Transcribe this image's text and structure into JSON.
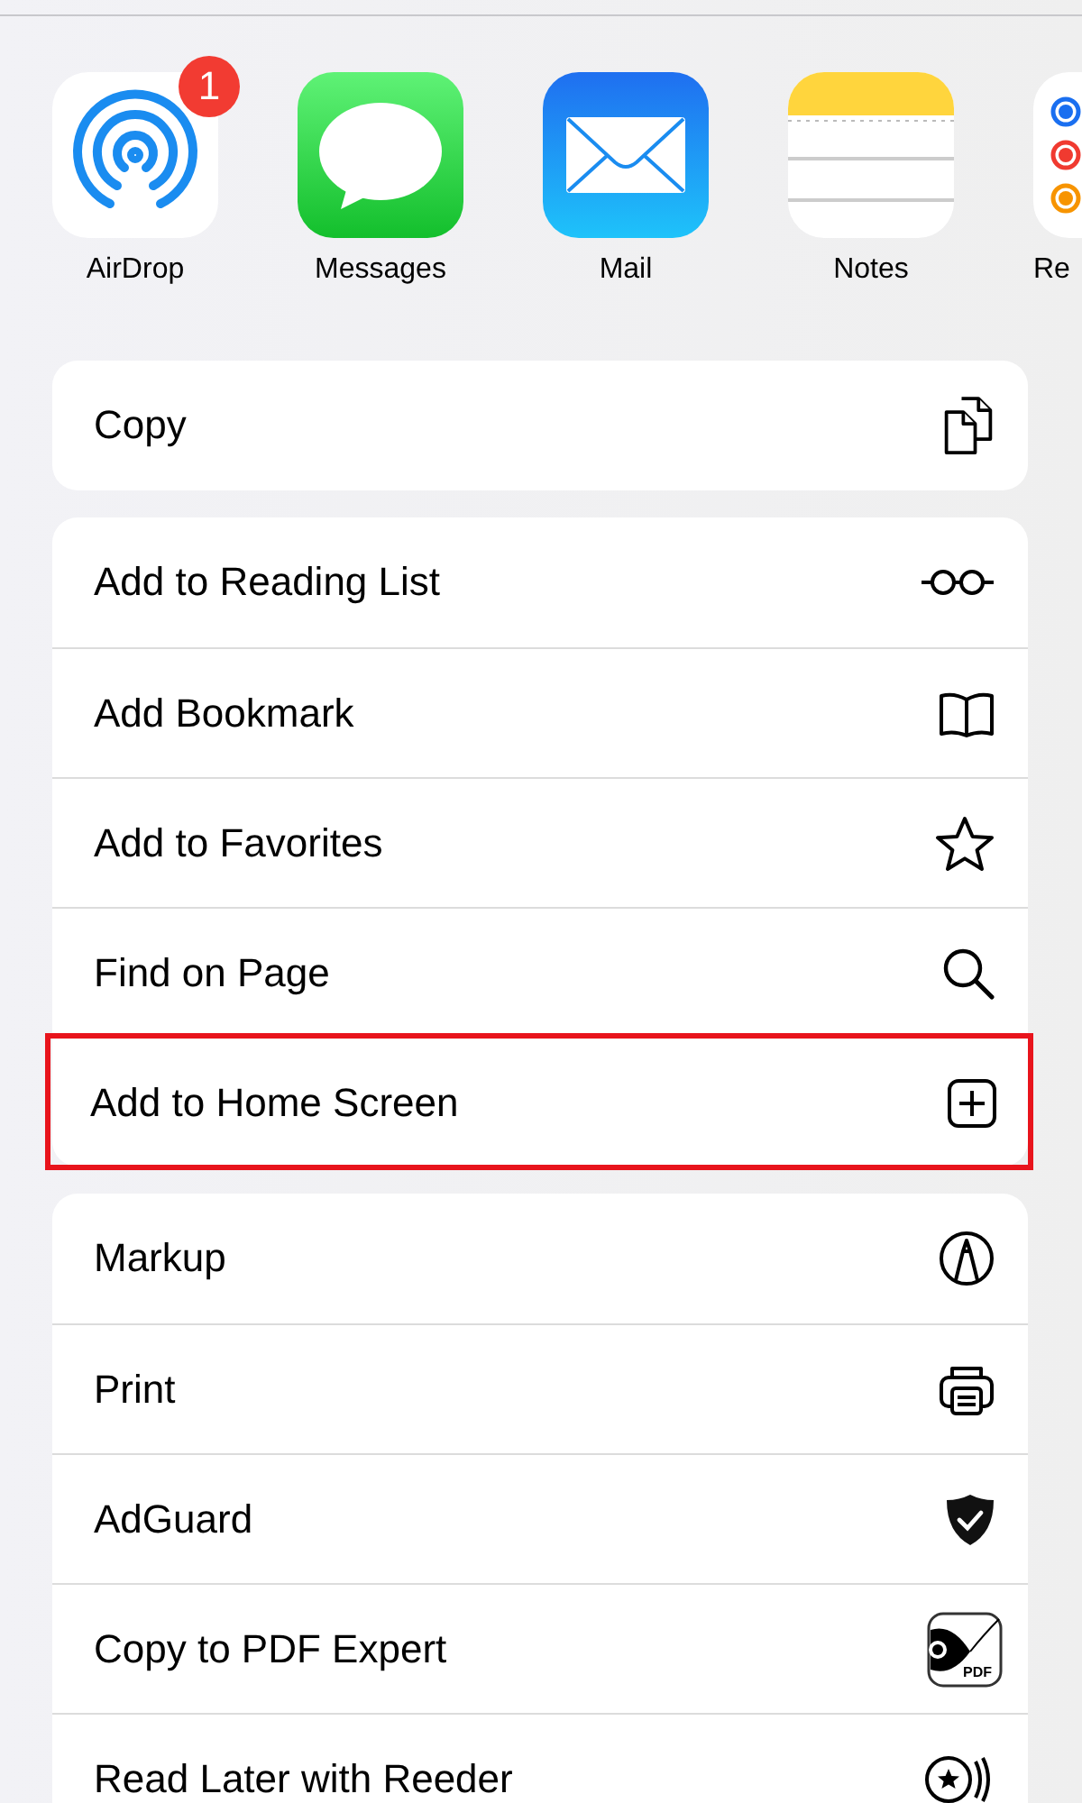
{
  "apps": [
    {
      "label": "AirDrop",
      "badge": "1"
    },
    {
      "label": "Messages"
    },
    {
      "label": "Mail"
    },
    {
      "label": "Notes"
    },
    {
      "label": "Re"
    }
  ],
  "action_groups": [
    {
      "rows": [
        {
          "label": "Copy",
          "highlighted": false
        }
      ]
    },
    {
      "rows": [
        {
          "label": "Add to Reading List",
          "highlighted": false
        },
        {
          "label": "Add Bookmark",
          "highlighted": false
        },
        {
          "label": "Add to Favorites",
          "highlighted": false
        },
        {
          "label": "Find on Page",
          "highlighted": false
        },
        {
          "label": "Add to Home Screen",
          "highlighted": true
        }
      ]
    },
    {
      "rows": [
        {
          "label": "Markup",
          "highlighted": false
        },
        {
          "label": "Print",
          "highlighted": false
        },
        {
          "label": "AdGuard",
          "highlighted": false
        },
        {
          "label": "Copy to PDF Expert",
          "highlighted": false,
          "icon_text": "PDF"
        },
        {
          "label": "Read Later with Reeder",
          "highlighted": false
        }
      ]
    }
  ]
}
